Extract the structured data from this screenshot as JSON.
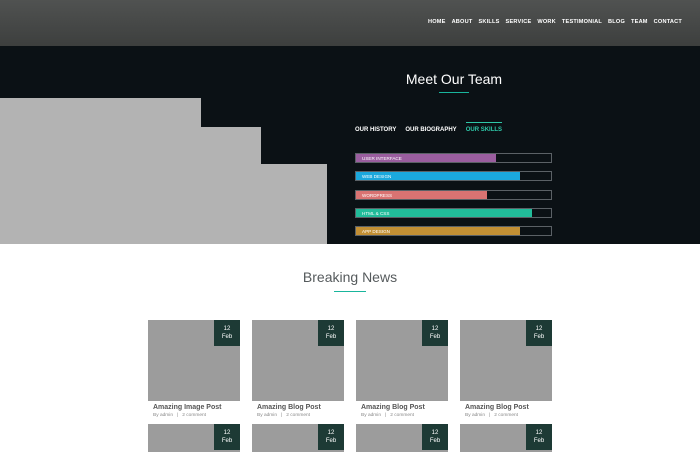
{
  "nav": {
    "items": [
      "HOME",
      "ABOUT",
      "SKILLS",
      "SERVICE",
      "WORK",
      "TESTIMONIAL",
      "BLOG",
      "TEAM",
      "CONTACT"
    ]
  },
  "team": {
    "title": "Meet Our Team",
    "tabs": [
      {
        "label": "OUR HISTORY"
      },
      {
        "label": "OUR BIOGRAPHY"
      },
      {
        "label": "OUR SKILLS"
      }
    ],
    "skills": [
      {
        "label": "USER INTERFACE",
        "level": 0.72,
        "color": "#9a5e9f"
      },
      {
        "label": "WEB DESIGN",
        "level": 0.84,
        "color": "#1ba8dd"
      },
      {
        "label": "WORDPRESS",
        "level": 0.67,
        "color": "#d97372"
      },
      {
        "label": "HTML & CSS",
        "level": 0.9,
        "color": "#21bc9a"
      },
      {
        "label": "APP DESIGN",
        "level": 0.84,
        "color": "#c28f34"
      }
    ]
  },
  "news": {
    "title": "Breaking News",
    "cards": [
      {
        "title": "Amazing Image Post",
        "day": "12",
        "month": "Feb",
        "by": "By",
        "author": "admin",
        "comments": "2 comment"
      },
      {
        "title": "Amazing Blog Post",
        "day": "12",
        "month": "Feb",
        "by": "By",
        "author": "admin",
        "comments": "2 comment"
      },
      {
        "title": "Amazing Blog Post",
        "day": "12",
        "month": "Feb",
        "by": "By",
        "author": "admin",
        "comments": "2 comment"
      },
      {
        "title": "Amazing Blog Post",
        "day": "12",
        "month": "Feb",
        "by": "By",
        "author": "admin",
        "comments": "2 comment"
      }
    ],
    "row2": [
      {
        "day": "12",
        "month": "Feb"
      },
      {
        "day": "12",
        "month": "Feb"
      },
      {
        "day": "12",
        "month": "Feb"
      },
      {
        "day": "12",
        "month": "Feb"
      }
    ]
  },
  "colors": {
    "accent": "#2fc7a8",
    "dark": "#0b1115",
    "date_bg": "#1d3a35"
  }
}
